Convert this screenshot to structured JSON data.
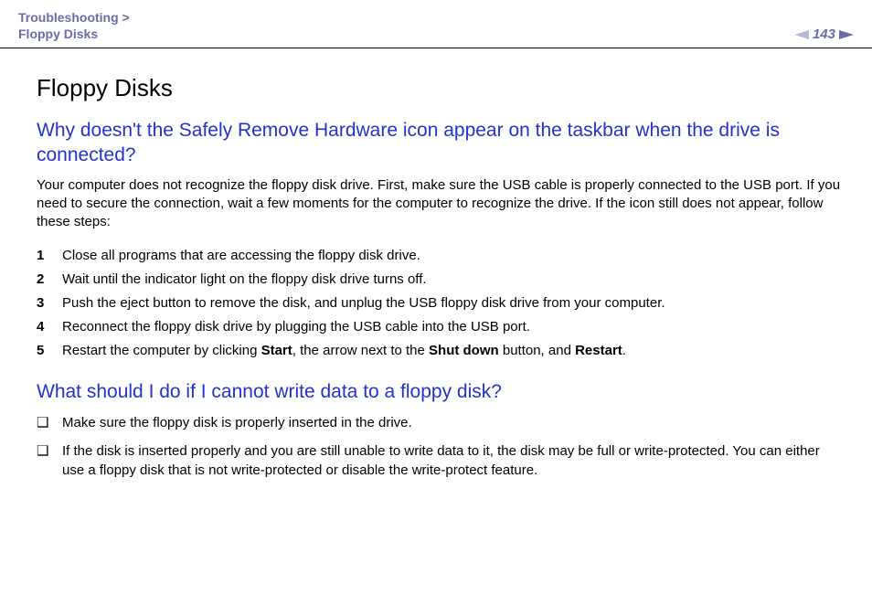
{
  "header": {
    "breadcrumb_line1": "Troubleshooting >",
    "breadcrumb_line2": "Floppy Disks",
    "page_number": "143"
  },
  "page": {
    "title": "Floppy Disks",
    "section1": {
      "heading": "Why doesn't the Safely Remove Hardware icon appear on the taskbar when the drive is connected?",
      "intro": "Your computer does not recognize the floppy disk drive. First, make sure the USB cable is properly connected to the USB port. If you need to secure the connection, wait a few moments for the computer to recognize the drive. If the icon still does not appear, follow these steps:",
      "steps": [
        "Close all programs that are accessing the floppy disk drive.",
        "Wait until the indicator light on the floppy disk drive turns off.",
        "Push the eject button to remove the disk, and unplug the USB floppy disk drive from your computer.",
        "Reconnect the floppy disk drive by plugging the USB cable into the USB port."
      ],
      "step5_pre": "Restart the computer by clicking ",
      "step5_b1": "Start",
      "step5_mid1": ", the arrow next to the ",
      "step5_b2": "Shut down",
      "step5_mid2": " button, and ",
      "step5_b3": "Restart",
      "step5_post": "."
    },
    "section2": {
      "heading": "What should I do if I cannot write data to a floppy disk?",
      "bullets": [
        "Make sure the floppy disk is properly inserted in the drive.",
        "If the disk is inserted properly and you are still unable to write data to it, the disk may be full or write-protected. You can either use a floppy disk that is not write-protected or disable the write-protect feature."
      ]
    }
  }
}
